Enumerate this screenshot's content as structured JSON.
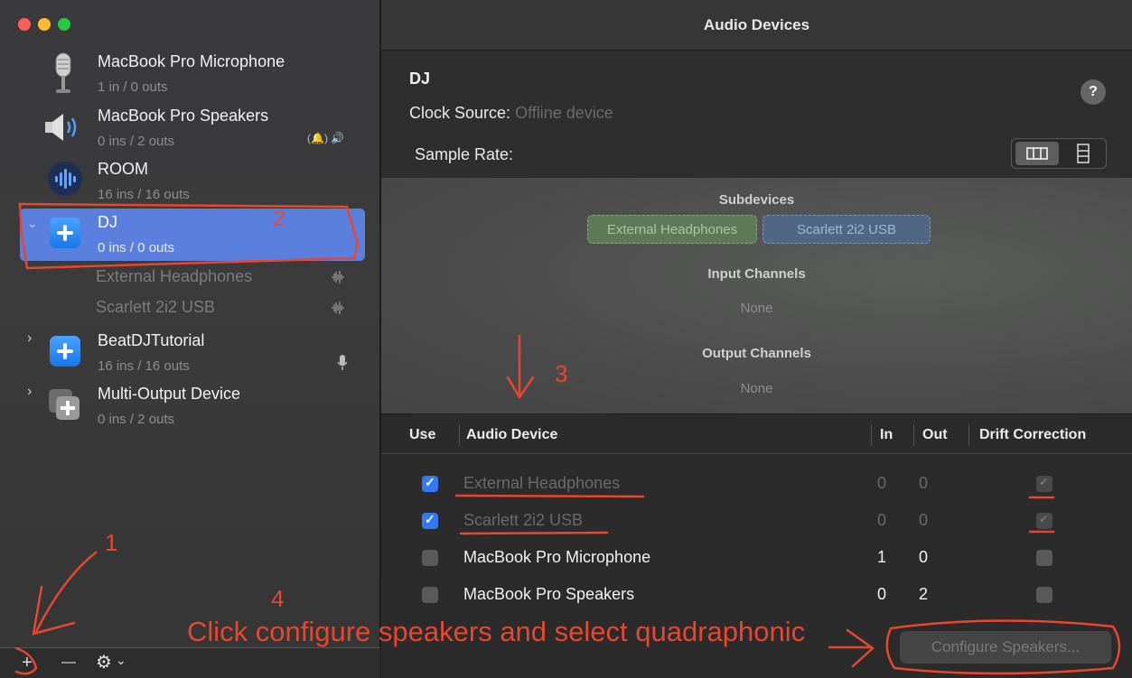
{
  "window": {
    "title": "Audio Devices"
  },
  "sidebar": {
    "devices": [
      {
        "name": "MacBook Pro Microphone",
        "io": "1 in / 0 outs",
        "icon": "microphone-icon"
      },
      {
        "name": "MacBook Pro Speakers",
        "io": "0 ins / 2 outs",
        "icon": "speaker-icon"
      },
      {
        "name": "ROOM",
        "io": "16 ins / 16 outs",
        "icon": "room-waveform-icon"
      },
      {
        "name": "DJ",
        "io": "0 ins / 0 outs",
        "icon": "aggregate-plus-icon"
      },
      {
        "name": "BeatDJTutorial",
        "io": "16 ins / 16 outs",
        "icon": "aggregate-plus-icon"
      },
      {
        "name": "Multi-Output Device",
        "io": "0 ins / 2 outs",
        "icon": "multi-output-icon"
      }
    ],
    "dj_subdevices": [
      "External Headphones",
      "Scarlett 2i2 USB"
    ],
    "speaker_badges": "(🔔) 🔊",
    "bottom": {
      "add": "+",
      "remove": "—",
      "gear": "⚙",
      "chevron": "⌄"
    }
  },
  "device_panel": {
    "name": "DJ",
    "clock_label": "Clock Source:",
    "clock_value": "Offline device",
    "sample_rate_label": "Sample Rate:",
    "help": "?"
  },
  "subdevices_panel": {
    "title": "Subdevices",
    "chips": [
      "External Headphones",
      "Scarlett 2i2 USB"
    ],
    "input_title": "Input Channels",
    "input_value": "None",
    "output_title": "Output Channels",
    "output_value": "None"
  },
  "table": {
    "headers": {
      "use": "Use",
      "device": "Audio Device",
      "in": "In",
      "out": "Out",
      "drift": "Drift Correction"
    },
    "rows": [
      {
        "use": true,
        "name": "External Headphones",
        "in": "0",
        "out": "0",
        "drift": true
      },
      {
        "use": true,
        "name": "Scarlett 2i2 USB",
        "in": "0",
        "out": "0",
        "drift": true
      },
      {
        "use": false,
        "name": "MacBook Pro Microphone",
        "in": "1",
        "out": "0",
        "drift": false
      },
      {
        "use": false,
        "name": "MacBook Pro Speakers",
        "in": "0",
        "out": "2",
        "drift": false
      }
    ]
  },
  "configure_button": "Configure Speakers...",
  "annotations": {
    "n1": "1",
    "n2": "2",
    "n3": "3",
    "n4": "4",
    "instruction": "Click configure speakers and select quadraphonic",
    "color": "#e8472f"
  }
}
